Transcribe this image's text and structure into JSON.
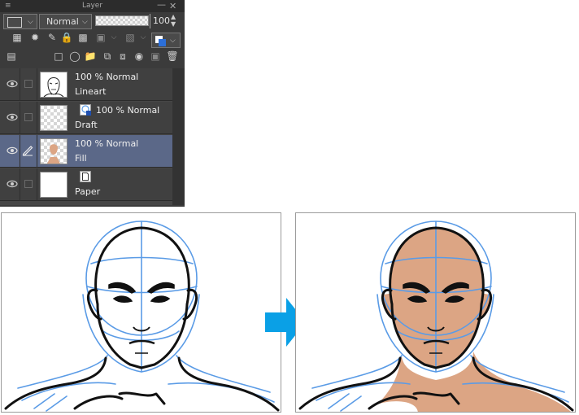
{
  "panel": {
    "title": "Layer",
    "blend_mode": "Normal",
    "opacity": "100",
    "layers": [
      {
        "opacity_mode": "100 % Normal",
        "name": "Lineart",
        "selected": false
      },
      {
        "opacity_mode": "100 % Normal",
        "name": "Draft",
        "selected": false
      },
      {
        "opacity_mode": "100 % Normal",
        "name": "Fill",
        "selected": true
      },
      {
        "opacity_mode": "",
        "name": "Paper",
        "selected": false
      }
    ]
  },
  "colors": {
    "panel_bg": "#3b3b3b",
    "selected_layer": "#5b6888",
    "skin_fill": "#dca584",
    "sketch_blue": "#5a9be6",
    "arrow": "#0aa0e6"
  },
  "icons": [
    "menu-icon",
    "minimize-icon",
    "close-icon",
    "eye-icon",
    "pen-icon",
    "lock-icon",
    "trash-icon",
    "new-layer-icon",
    "folder-icon"
  ]
}
